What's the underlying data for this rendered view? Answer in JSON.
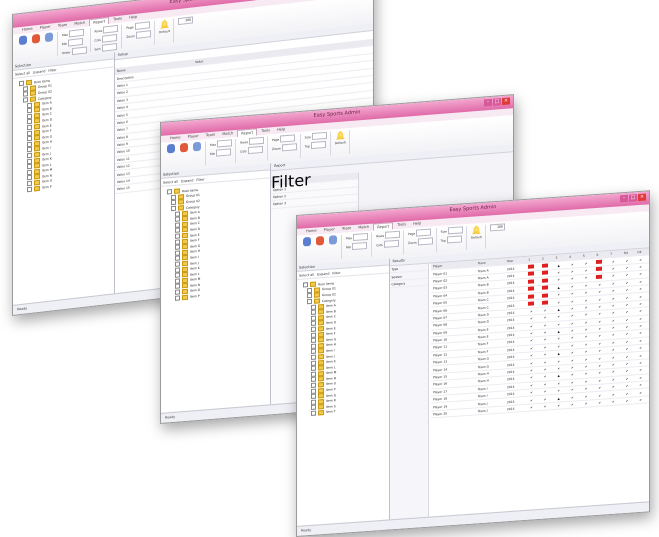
{
  "colors": {
    "title_bar": "#e06aa8",
    "accent_yellow": "#f0b400",
    "ok_green": "#1a9a2a",
    "error_red": "#e02020"
  },
  "windows": [
    {
      "title": "Easy Sports Admin",
      "tabs": [
        "Home",
        "Player",
        "Team",
        "Match",
        "Report",
        "Tools",
        "Help"
      ],
      "active_tab": "Report",
      "ribbon": {
        "fields": [
          [
            "Max",
            "Min",
            "Order"
          ],
          [
            "Rows",
            "Cols",
            "Sort"
          ],
          [
            "Page",
            "Zoom",
            "Fit"
          ],
          [
            "Size",
            "Top",
            "Left"
          ]
        ],
        "button": "Default",
        "count": "100"
      },
      "left_header": "Selection",
      "left_tools": [
        "Select all",
        "Expand",
        "Filter"
      ],
      "tree": [
        "Root items",
        "Group 01",
        "Group 02",
        "Category",
        "Item A",
        "Item B",
        "Item C",
        "Item D",
        "Item E",
        "Item F",
        "Item G",
        "Item H",
        "Item I",
        "Item J",
        "Item K",
        "Item L",
        "Item M",
        "Item N",
        "Item O",
        "Item P"
      ],
      "doc_tab": "Setup",
      "grid_cols": [
        "Name",
        "Value"
      ],
      "grid_rows": [
        "Description",
        "Value 1",
        "Value 2",
        "Value 3",
        "Value 4",
        "Value 5",
        "Value 6",
        "Value 7",
        "Value 8",
        "Value 9",
        "Value 10",
        "Value 11",
        "Value 12",
        "Value 13",
        "Value 14",
        "Value 15"
      ],
      "status": "Ready"
    },
    {
      "title": "Easy Sports Admin",
      "tabs": [
        "Home",
        "Player",
        "Team",
        "Match",
        "Report",
        "Tools",
        "Help"
      ],
      "active_tab": "Report",
      "ribbon": {
        "fields": [
          [
            "Max",
            "Min",
            "Order"
          ],
          [
            "Rows",
            "Cols",
            "Sort"
          ],
          [
            "Page",
            "Zoom",
            "Fit"
          ],
          [
            "Size",
            "Top",
            "Left"
          ]
        ],
        "button": "Default",
        "count": "100"
      },
      "left_header": "Selection",
      "left_tools": [
        "Select all",
        "Expand",
        "Filter"
      ],
      "tree": [
        "Root items",
        "Group 01",
        "Group 02",
        "Category",
        "Item A",
        "Item B",
        "Item C",
        "Item D",
        "Item E",
        "Item F",
        "Item G",
        "Item H",
        "Item I",
        "Item J",
        "Item K",
        "Item L",
        "Item M",
        "Item N",
        "Item O",
        "Item P"
      ],
      "doc_tab": "Report",
      "grid_cols": [
        "Filter"
      ],
      "grid_rows": [
        "Option 1",
        "Option 2",
        "Option 3"
      ],
      "status": "Ready"
    },
    {
      "title": "Easy Sports Admin",
      "tabs": [
        "Home",
        "Player",
        "Team",
        "Match",
        "Report",
        "Tools",
        "Help"
      ],
      "active_tab": "Report",
      "ribbon": {
        "fields": [
          [
            "Max",
            "Min",
            "Order"
          ],
          [
            "Rows",
            "Cols",
            "Sort"
          ],
          [
            "Page",
            "Zoom",
            "Fit"
          ],
          [
            "Size",
            "Top",
            "Left"
          ]
        ],
        "button": "Default",
        "count": "100"
      },
      "left_header": "Selection",
      "left_tools": [
        "Select all",
        "Expand",
        "Filter"
      ],
      "tree": [
        "Root items",
        "Group 01",
        "Group 02",
        "Category",
        "Item A",
        "Item B",
        "Item C",
        "Item D",
        "Item E",
        "Item F",
        "Item G",
        "Item H",
        "Item I",
        "Item J",
        "Item K",
        "Item L",
        "Item M",
        "Item N",
        "Item O",
        "Item P",
        "Item Q",
        "Item R",
        "Item S",
        "Item T"
      ],
      "doc_tab": "Results",
      "side_filter": [
        "Type",
        "Season",
        "Category"
      ],
      "grid_cols": [
        "Player",
        "Team",
        "Year",
        "1",
        "2",
        "3",
        "4",
        "5",
        "6",
        "7",
        "Tot",
        "Ok"
      ],
      "grid_rows": [
        [
          "Player 01",
          "Team A",
          "2014"
        ],
        [
          "Player 02",
          "Team A",
          "2014"
        ],
        [
          "Player 03",
          "Team B",
          "2014"
        ],
        [
          "Player 04",
          "Team B",
          "2014"
        ],
        [
          "Player 05",
          "Team C",
          "2014"
        ],
        [
          "Player 06",
          "Team C",
          "2014"
        ],
        [
          "Player 07",
          "Team D",
          "2014"
        ],
        [
          "Player 08",
          "Team D",
          "2014"
        ],
        [
          "Player 09",
          "Team E",
          "2014"
        ],
        [
          "Player 10",
          "Team E",
          "2014"
        ],
        [
          "Player 11",
          "Team F",
          "2014"
        ],
        [
          "Player 12",
          "Team F",
          "2014"
        ],
        [
          "Player 13",
          "Team G",
          "2014"
        ],
        [
          "Player 14",
          "Team G",
          "2014"
        ],
        [
          "Player 15",
          "Team H",
          "2014"
        ],
        [
          "Player 16",
          "Team H",
          "2014"
        ],
        [
          "Player 17",
          "Team I",
          "2014"
        ],
        [
          "Player 18",
          "Team I",
          "2014"
        ],
        [
          "Player 19",
          "Team J",
          "2014"
        ],
        [
          "Player 20",
          "Team J",
          "2014"
        ]
      ],
      "status": "Ready"
    }
  ]
}
